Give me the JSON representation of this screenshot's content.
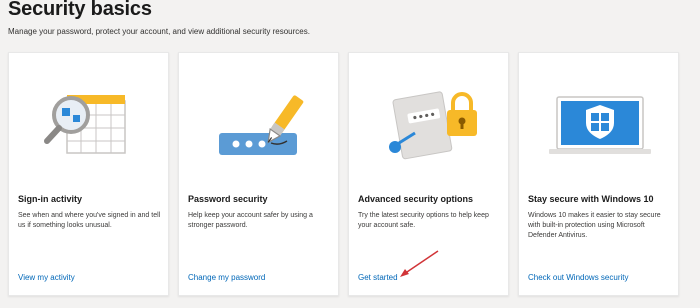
{
  "header": {
    "title": "Security basics",
    "subtitle": "Manage your password, protect your account, and view additional security resources."
  },
  "cards": [
    {
      "title": "Sign-in activity",
      "description": "See when and where you've signed in and tell us if something looks unusual.",
      "link": "View my activity",
      "icon": "sign-in-activity-icon"
    },
    {
      "title": "Password security",
      "description": "Help keep your account safer by using a stronger password.",
      "link": "Change my password",
      "icon": "password-icon"
    },
    {
      "title": "Advanced security options",
      "description": "Try the latest security options to help keep your account safe.",
      "link": "Get started",
      "icon": "advanced-security-icon"
    },
    {
      "title": "Stay secure with Windows 10",
      "description": "Windows 10 makes it easier to stay secure with built-in protection using Microsoft Defender Antivirus.",
      "link": "Check out Windows security",
      "icon": "windows-security-icon"
    }
  ],
  "colors": {
    "link": "#0067b8",
    "accent_blue": "#5b9bd5",
    "accent_yellow": "#f7b928",
    "annotation_arrow": "#d13438"
  }
}
